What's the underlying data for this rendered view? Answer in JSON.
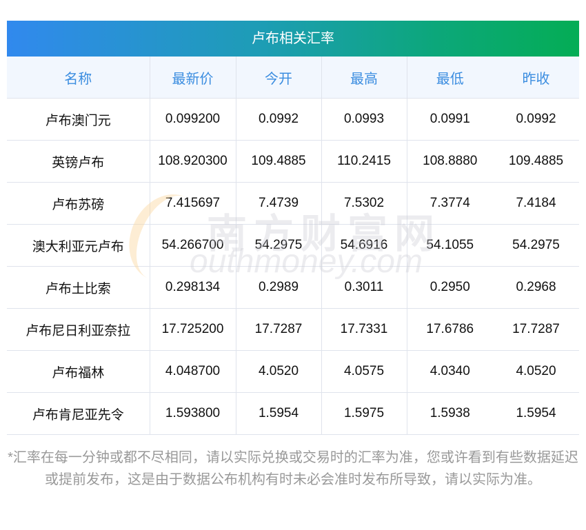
{
  "title": "卢布相关汇率",
  "columns": [
    "名称",
    "最新价",
    "今开",
    "最高",
    "最低",
    "昨收"
  ],
  "rows": [
    [
      "卢布澳门元",
      "0.099200",
      "0.0992",
      "0.0993",
      "0.0991",
      "0.0992"
    ],
    [
      "英镑卢布",
      "108.920300",
      "109.4885",
      "110.2415",
      "108.8880",
      "109.4885"
    ],
    [
      "卢布苏磅",
      "7.415697",
      "7.4739",
      "7.5302",
      "7.3774",
      "7.4184"
    ],
    [
      "澳大利亚元卢布",
      "54.266700",
      "54.2975",
      "54.6916",
      "54.1055",
      "54.2975"
    ],
    [
      "卢布土比索",
      "0.298134",
      "0.2989",
      "0.3011",
      "0.2950",
      "0.2968"
    ],
    [
      "卢布尼日利亚奈拉",
      "17.725200",
      "17.7287",
      "17.7331",
      "17.6786",
      "17.7287"
    ],
    [
      "卢布福林",
      "4.048700",
      "4.0520",
      "4.0575",
      "4.0340",
      "4.0520"
    ],
    [
      "卢布肯尼亚先令",
      "1.593800",
      "1.5954",
      "1.5975",
      "1.5938",
      "1.5954"
    ]
  ],
  "note": "*汇率在每一分钟或都不尽相同，请以实际兑换或交易时的汇率为准，您或许看到有些数据延迟或提前发布，这是由于数据公布机构有时未必会准时发布所导致，请以实际为准。",
  "watermark": {
    "cn": "南方财富网",
    "en": "outhmoney.com"
  }
}
